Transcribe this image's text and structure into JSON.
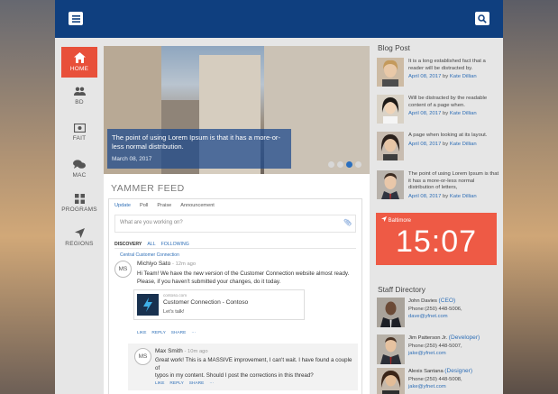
{
  "nav": [
    {
      "label": "HOME",
      "icon": "home-icon"
    },
    {
      "label": "BD",
      "icon": "users-icon"
    },
    {
      "label": "FAIT",
      "icon": "money-icon"
    },
    {
      "label": "MAC",
      "icon": "chat-icon"
    },
    {
      "label": "PROGRAMS",
      "icon": "grid-icon"
    },
    {
      "label": "REGIONS",
      "icon": "location-arrow-icon"
    }
  ],
  "hero": {
    "caption": "The point of using Lorem Ipsum is that it has a more-or-less normal distribution.",
    "date": "March 08, 2017"
  },
  "yammer": {
    "title": "YAMMER FEED",
    "tabs": [
      "Update",
      "Poll",
      "Praise",
      "Announcement"
    ],
    "compose_placeholder": "What are you working on?",
    "filters": [
      "DISCOVERY",
      "ALL",
      "FOLLOWING"
    ],
    "group": "Central Customer Connection",
    "post": {
      "initials": "MS",
      "author": "Michiyo Sato",
      "time": "- 12m ago",
      "line1": "Hi Team! We have the new version of the Customer Connection website almost ready.",
      "line2": "Please, if you haven't submitted your changes, do it today.",
      "card_site": "contoso.com",
      "card_title": "Customer Connection - Contoso",
      "card_desc": "Let's talk!",
      "actions": [
        "LIKE",
        "REPLY",
        "SHARE",
        "···"
      ]
    },
    "reply": {
      "initials": "MS",
      "author": "Max Smith",
      "time": "- 10m ago",
      "line1": "Great work! This is a MASSIVE improvement, I can't wait. I have found a couple of",
      "line2": "typos in my content. Should I post the corrections in this thread?",
      "actions": [
        "LIKE",
        "REPLY",
        "SHARE",
        "···"
      ]
    }
  },
  "blog": {
    "title": "Blog Post",
    "by": "by",
    "items": [
      {
        "text": "It is a long established fact that a reader will be distracted by.",
        "date": "April 08, 2017",
        "author": "Kate Dillian"
      },
      {
        "text": "Will be distracted by the readable content of a page when.",
        "date": "April 08, 2017",
        "author": "Kate Dillian"
      },
      {
        "text": "A page when looking at its layout.",
        "date": "April 08, 2017",
        "author": "Kate Dillian"
      },
      {
        "text": "The point of using Lorem Ipsum is that it has a more-or-less normal distribution of letters,",
        "date": "April 08, 2017",
        "author": "Kate Dillian"
      }
    ]
  },
  "clock": {
    "city": "Baltimore",
    "time": "15:07"
  },
  "staff": {
    "title": "Staff Directory",
    "items": [
      {
        "name": "John Davies",
        "role": "(CEO)",
        "phone": "Phone:(250) 448-5006,",
        "email": "dave@yfnet.com"
      },
      {
        "name": "Jim Patterson Jr.",
        "role": "(Developer)",
        "phone": "Phone:(250) 448-5007,",
        "email": "jake@yfnet.com"
      },
      {
        "name": "Alexis Santana",
        "role": "(Designer)",
        "phone": "Phone:(250) 448-5008,",
        "email": "jake@yfnet.com"
      }
    ]
  },
  "colors": {
    "topbar": "#0f3f7f",
    "accent": "#e8503a",
    "clock": "#ee5a45",
    "link": "#2f6fb7"
  }
}
